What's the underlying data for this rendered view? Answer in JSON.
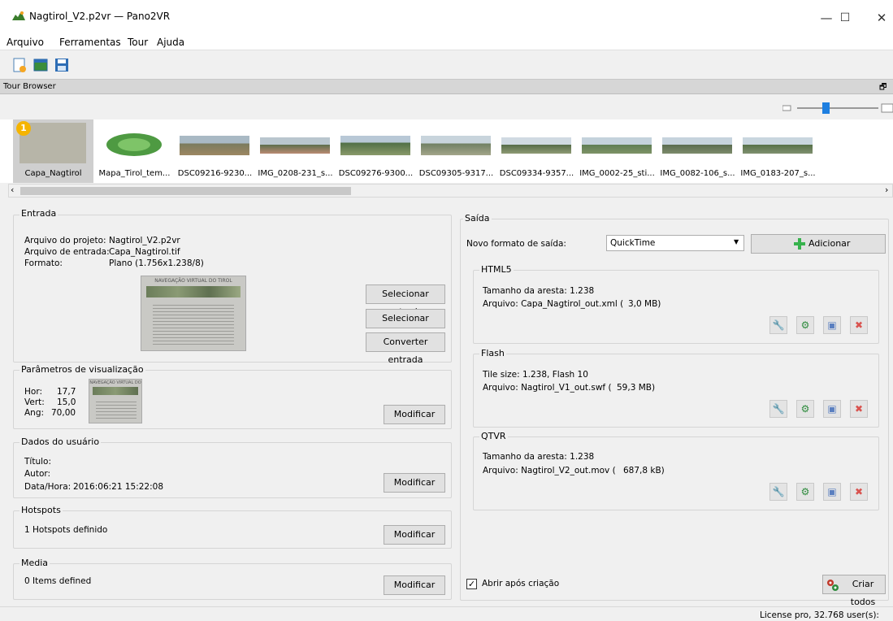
{
  "window": {
    "title": "Nagtirol_V2.p2vr — Pano2VR",
    "minimize": "—",
    "maximize": "☐",
    "close": "✕"
  },
  "menu": [
    "Arquivo",
    "Ferramentas",
    "Tour",
    "Ajuda"
  ],
  "dock": {
    "title": "Tour Browser",
    "float": "🗗"
  },
  "thumbnails": [
    {
      "label": "Capa_Nagtirol",
      "selected": true,
      "badge": "1",
      "color": "#b7b5a8"
    },
    {
      "label": "Mapa_Tirol_tem...",
      "selected": false,
      "color": "#4e9a42"
    },
    {
      "label": "DSC09216-9230...",
      "selected": false,
      "color": "#7a7a5d"
    },
    {
      "label": "IMG_0208-231_s...",
      "selected": false,
      "color": "#9a7b62"
    },
    {
      "label": "DSC09276-9300...",
      "selected": false,
      "color": "#6b8a5a"
    },
    {
      "label": "DSC09305-9317...",
      "selected": false,
      "color": "#8da2ad"
    },
    {
      "label": "DSC09334-9357...",
      "selected": false,
      "color": "#7e8a6a"
    },
    {
      "label": "IMG_0002-25_sti...",
      "selected": false,
      "color": "#5f7e54"
    },
    {
      "label": "IMG_0082-106_s...",
      "selected": false,
      "color": "#6a7a60"
    },
    {
      "label": "IMG_0183-207_s...",
      "selected": false,
      "color": "#607a58"
    }
  ],
  "input": {
    "group_title": "Entrada",
    "project_label": "Arquivo do projeto:",
    "project_value": "Nagtirol_V2.p2vr",
    "input_label": "Arquivo de entrada:",
    "input_value": "Capa_Nagtirol.tif",
    "format_label": "Formato:",
    "format_value": "Plano (1.756x1.238/8)",
    "preview_caption": "NAVEGAÇÃO VIRTUAL DO TIROL",
    "select_input": "Selecionar entrada",
    "select_patch": "Selecionar retalho",
    "convert_input": "Converter entrada"
  },
  "view_params": {
    "group_title": "Parâmetros de visualização",
    "hor_label": "Hor:",
    "hor_value": "17,7",
    "vert_label": "Vert:",
    "vert_value": "15,0",
    "ang_label": "Ang:",
    "ang_value": "70,00",
    "preview_caption": "NAVEGAÇÃO VIRTUAL DO",
    "modify": "Modificar"
  },
  "user_data": {
    "group_title": "Dados do usuário",
    "title_label": "Título:",
    "author_label": "Autor:",
    "datetime_label": "Data/Hora:",
    "datetime_value": "2016:06:21 15:22:08",
    "modify": "Modificar"
  },
  "hotspots": {
    "group_title": "Hotspots",
    "text": "1 Hotspots definido",
    "modify": "Modificar"
  },
  "media": {
    "group_title": "Media",
    "text": "0 Items defined",
    "modify": "Modificar"
  },
  "output": {
    "group_title": "Saída",
    "new_format_label": "Novo formato de saída:",
    "format_selected": "QuickTime",
    "add_button": "Adicionar",
    "formats": [
      {
        "name": "HTML5",
        "line1": "Tamanho da aresta: 1.238",
        "file_label": "Arquivo: Capa_Nagtirol_out.xml (",
        "size": "3,0 MB)"
      },
      {
        "name": "Flash",
        "line1": "Tile size: 1.238, Flash 10",
        "file_label": "Arquivo: Nagtirol_V1_out.swf (",
        "size": "59,3 MB)"
      },
      {
        "name": "QTVR",
        "line1": "Tamanho da aresta: 1.238",
        "file_label": "Arquivo: Nagtirol_V2_out.mov (",
        "size": "687,8 kB)"
      }
    ],
    "open_after": "Abrir após criação",
    "open_after_checked": true,
    "create_all": "Criar todos"
  },
  "status": {
    "license": "License pro, 32.768 user(s):"
  },
  "colors": {
    "add_green": "#37b24d",
    "delete_red": "#d9534f",
    "gear_green": "#2e8b3d",
    "slider_blue": "#1e7fe0"
  }
}
